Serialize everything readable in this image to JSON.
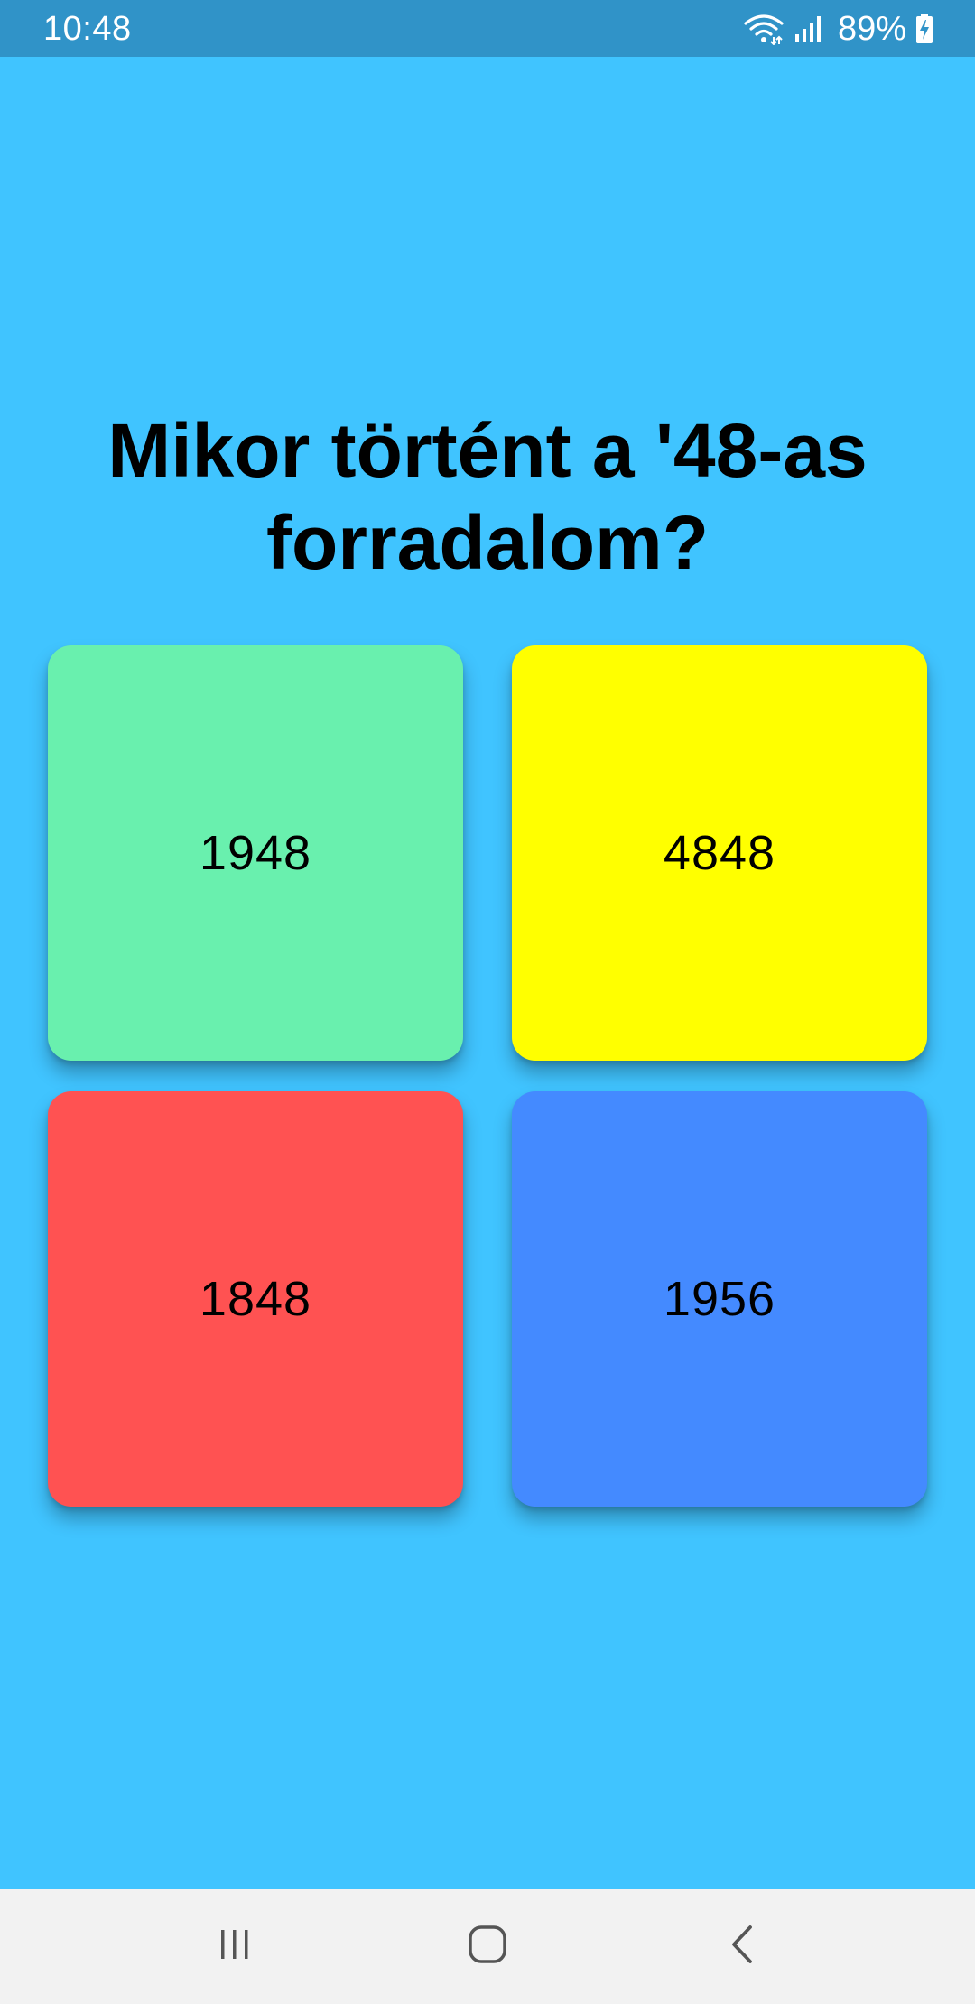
{
  "status_bar": {
    "time": "10:48",
    "battery_percent": "89%",
    "icons": [
      "wifi-icon",
      "signal-icon",
      "battery-charging-icon"
    ]
  },
  "question": {
    "text": "Mikor történt a '48-as forradalom?"
  },
  "answers": [
    {
      "label": "1948",
      "color": "#69f0ae"
    },
    {
      "label": "4848",
      "color": "#ffff00"
    },
    {
      "label": "1848",
      "color": "#ff5252"
    },
    {
      "label": "1956",
      "color": "#448aff"
    }
  ],
  "colors": {
    "background": "#40c4ff",
    "status_bar": "#3093c8",
    "nav_bar": "#f2f2f2"
  },
  "nav_bar": {
    "icons": [
      "recents-icon",
      "home-icon",
      "back-icon"
    ]
  }
}
